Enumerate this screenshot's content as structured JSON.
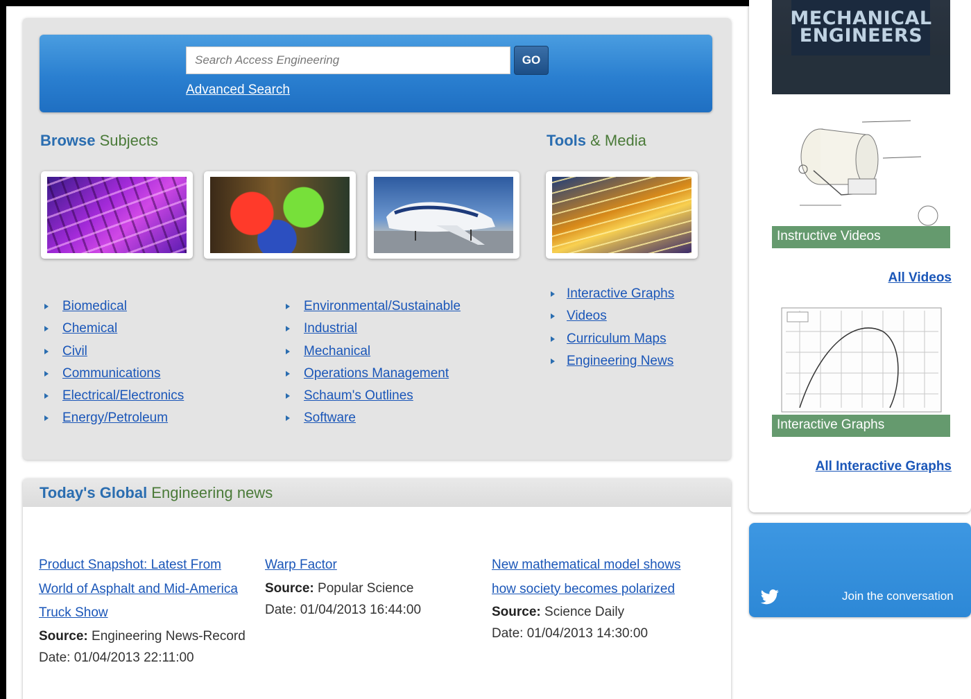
{
  "search": {
    "placeholder": "Search Access Engineering",
    "go_label": "GO",
    "advanced_label": "Advanced Search"
  },
  "browse": {
    "heading_highlight": "Browse",
    "heading_rest": " Subjects",
    "subjects_col1": [
      "Biomedical",
      "Chemical",
      "Civil",
      "Communications",
      "Electrical/Electronics",
      "Energy/Petroleum"
    ],
    "subjects_col2": [
      "Environmental/Sustainable",
      "Industrial",
      "Mechanical",
      "Operations Management",
      "Schaum's Outlines",
      "Software"
    ]
  },
  "tools": {
    "heading_highlight": "Tools",
    "heading_rest": " & Media",
    "items": [
      "Interactive Graphs",
      "Videos",
      "Curriculum Maps",
      "Engineering News"
    ]
  },
  "news": {
    "heading_highlight": "Today's Global",
    "heading_rest": " Engineering news",
    "source_label": "Source:",
    "items": [
      {
        "title": "Product Snapshot: Latest From World of Asphalt and Mid-America Truck Show",
        "source": "Engineering News-Record",
        "date": "Date: 01/04/2013 22:11:00"
      },
      {
        "title": "Warp Factor",
        "source": "Popular Science",
        "date": "Date: 01/04/2013 16:44:00"
      },
      {
        "title": "New mathematical model shows how society becomes polarized",
        "source": "Science Daily",
        "date": "Date: 01/04/2013 14:30:00"
      }
    ]
  },
  "sidebar": {
    "book_title_line1": "MECHANICAL",
    "book_title_line2": "ENGINEERS",
    "videos_caption": "Instructive Videos",
    "all_videos": "All Videos",
    "graphs_caption": "Interactive Graphs",
    "all_graphs": "All Interactive Graphs"
  },
  "twitter": {
    "icon": "twitter-bird-icon",
    "text": "Join the conversation"
  },
  "colors": {
    "link": "#1a56b8",
    "heading_blue": "#2a6db0",
    "heading_green": "#4a7a38",
    "search_bar": "#2a7fd0",
    "twitter": "#3d97e2"
  }
}
